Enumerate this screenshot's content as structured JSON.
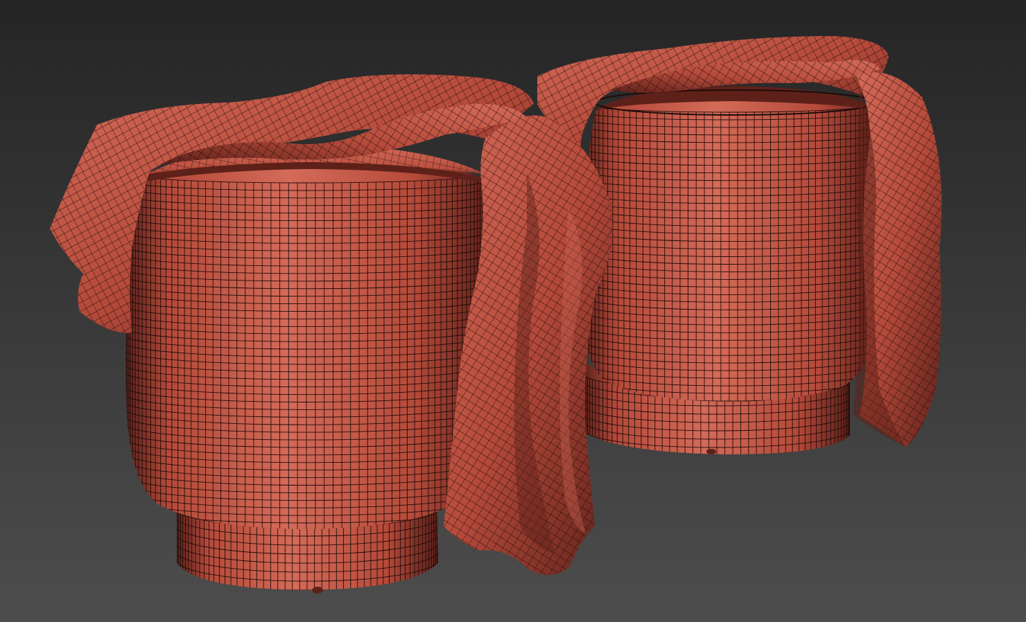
{
  "scene": {
    "background": {
      "top": "#252525",
      "bottom": "#4d4d4d"
    },
    "material": {
      "base": "#b54a3a",
      "light": "#d46a58",
      "dark": "#5e211a",
      "wire": "#1e0c0a"
    },
    "objects": [
      {
        "name": "pouf-left",
        "kind": "cylindrical pouf with draped throw"
      },
      {
        "name": "pouf-right",
        "kind": "cylindrical pouf with draped throw"
      }
    ]
  }
}
